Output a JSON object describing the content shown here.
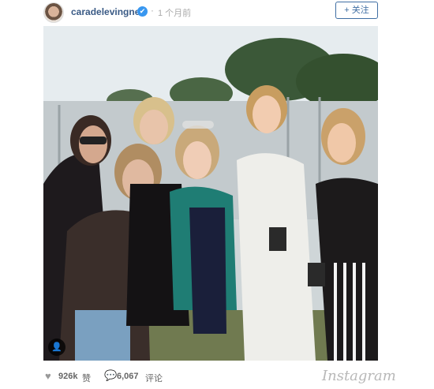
{
  "post": {
    "username": "caradelevingne",
    "verified_icon": "verified-check-icon",
    "separator": "·",
    "time": "1 个月前",
    "follow_label": "+ 关注"
  },
  "photo": {
    "tag_icon": "person-tag-icon",
    "colors": {
      "sky": "#e9eef1",
      "trees": "#3f5a3a",
      "wall": "#c6cdd0",
      "grass": "#6e7a4a"
    }
  },
  "stats": {
    "likes": "926k",
    "likes_suffix": "赞",
    "comments": "6,067",
    "comments_suffix": "评论"
  },
  "brand": "Instagram"
}
